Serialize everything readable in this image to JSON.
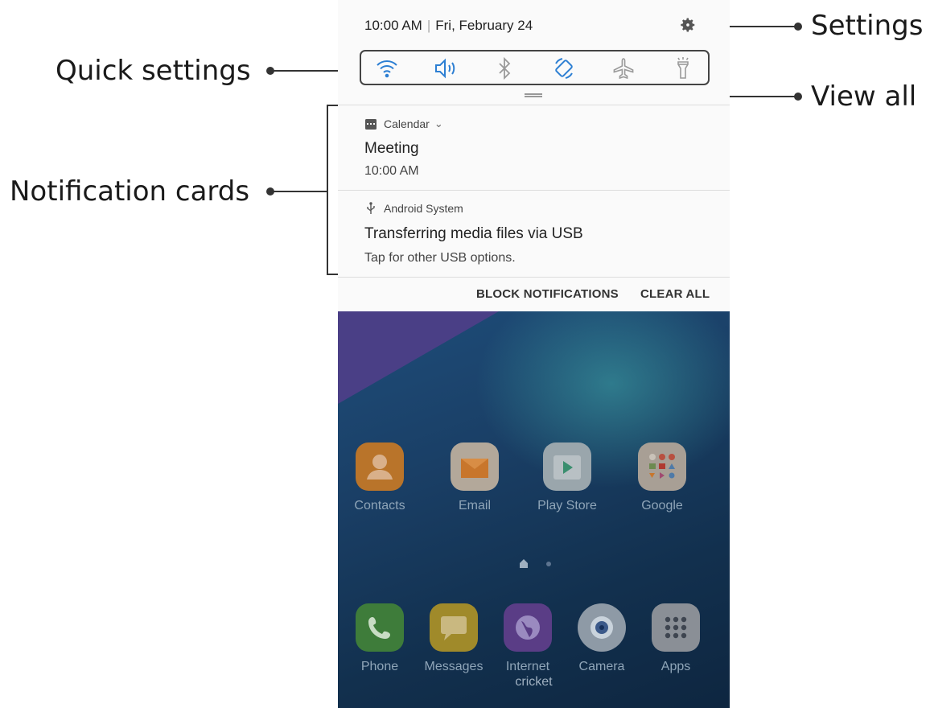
{
  "annotations": {
    "settings": "Settings",
    "quick_settings": "Quick settings",
    "view_all": "View all",
    "notification_cards": "Notification cards"
  },
  "status": {
    "time": "10:00 AM",
    "separator": "|",
    "date": "Fri, February 24"
  },
  "quick_settings": [
    {
      "icon": "wifi-icon"
    },
    {
      "icon": "sound-icon"
    },
    {
      "icon": "bluetooth-icon"
    },
    {
      "icon": "auto-rotate-icon"
    },
    {
      "icon": "airplane-mode-icon"
    },
    {
      "icon": "flashlight-icon"
    }
  ],
  "notifications": [
    {
      "app": "Calendar",
      "title": "Meeting",
      "subtitle": "10:00 AM",
      "icon": "calendar-icon",
      "expand": "⌄"
    },
    {
      "app": "Android System",
      "title": "Transferring media files via USB",
      "subtitle": "Tap for other USB options.",
      "icon": "usb-icon"
    }
  ],
  "actions": {
    "block": "BLOCK NOTIFICATIONS",
    "clear": "CLEAR ALL"
  },
  "home": {
    "apps": [
      {
        "label": "Contacts",
        "color": "#b9742a"
      },
      {
        "label": "Email",
        "color": "#b3a89a"
      },
      {
        "label": "Play Store",
        "color": "#9aa6ac"
      },
      {
        "label": "Google",
        "color": "#a89f95"
      }
    ],
    "dock": [
      {
        "label": "Phone",
        "color": "#3e7c3a"
      },
      {
        "label": "Messages",
        "color": "#a08a2a"
      },
      {
        "label": "Internet",
        "color": "#5a3d86"
      },
      {
        "label": "Camera",
        "color": "#8e9aa6"
      },
      {
        "label": "Apps",
        "color": "#8a8f96"
      }
    ],
    "carrier": "cricket"
  },
  "colors": {
    "accent_blue": "#2d7fd3",
    "icon_gray": "#9a9a9a"
  }
}
